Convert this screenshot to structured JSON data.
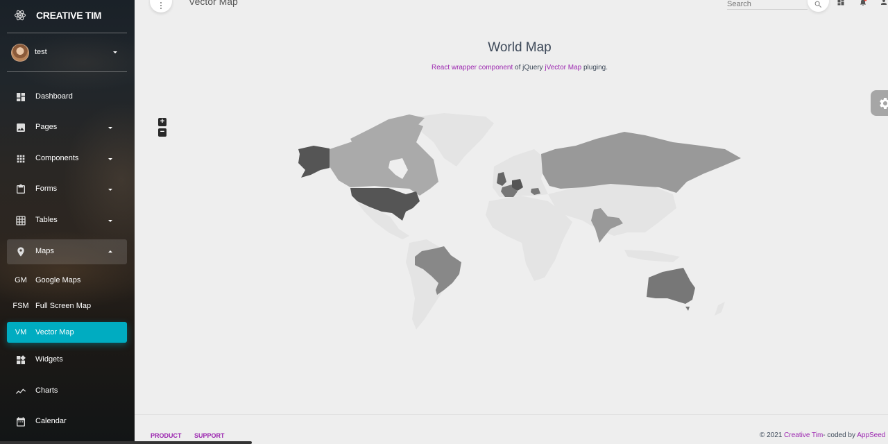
{
  "sidebar": {
    "brand": "CREATIVE TIM",
    "user": {
      "name": "test"
    },
    "items": [
      {
        "label": "Dashboard",
        "icon": "dashboard-icon",
        "has_caret": false
      },
      {
        "label": "Pages",
        "icon": "image-icon",
        "has_caret": true
      },
      {
        "label": "Components",
        "icon": "apps-icon",
        "has_caret": true
      },
      {
        "label": "Forms",
        "icon": "clipboard-icon",
        "has_caret": true
      },
      {
        "label": "Tables",
        "icon": "grid-on-icon",
        "has_caret": true
      },
      {
        "label": "Maps",
        "icon": "place-icon",
        "has_caret": true,
        "expanded": true
      },
      {
        "label": "Widgets",
        "icon": "widgets-icon",
        "has_caret": false
      },
      {
        "label": "Charts",
        "icon": "timeline-icon",
        "has_caret": false
      },
      {
        "label": "Calendar",
        "icon": "calendar-icon",
        "has_caret": false
      }
    ],
    "maps_subitems": [
      {
        "abbr": "GM",
        "label": "Google Maps",
        "active": false
      },
      {
        "abbr": "FSM",
        "label": "Full Screen Map",
        "active": false
      },
      {
        "abbr": "VM",
        "label": "Vector Map",
        "active": true
      }
    ],
    "active_color": "#00acc1"
  },
  "header": {
    "page_title": "Vector Map",
    "search_placeholder": "Search",
    "icons": [
      "search-icon",
      "dashboard-icon",
      "notifications-icon",
      "person-icon"
    ]
  },
  "card": {
    "title": "World Map",
    "subtitle_link1": "React wrapper component",
    "subtitle_mid": " of jQuery ",
    "subtitle_link2": "jVector Map",
    "subtitle_end": " pluging."
  },
  "map": {
    "zoom_in": "+",
    "zoom_out": "−",
    "highlighted_regions": [
      {
        "name": "United States",
        "shade": "#555555"
      },
      {
        "name": "Canada",
        "shade": "#aaaaaa"
      },
      {
        "name": "Brazil",
        "shade": "#888888"
      },
      {
        "name": "Russia",
        "shade": "#999999"
      },
      {
        "name": "Germany",
        "shade": "#555555"
      },
      {
        "name": "France",
        "shade": "#777777"
      },
      {
        "name": "United Kingdom",
        "shade": "#666666"
      },
      {
        "name": "Romania",
        "shade": "#777777"
      },
      {
        "name": "India",
        "shade": "#999999"
      },
      {
        "name": "Australia",
        "shade": "#777777"
      }
    ],
    "base_color": "#e4e4e4"
  },
  "footer": {
    "links": [
      "PRODUCT",
      "SUPPORT"
    ],
    "copyright_prefix": "© 2021 ",
    "copyright_link1": "Creative Tim",
    "copyright_mid": "- coded by ",
    "copyright_link2": "AppSeed"
  },
  "accent_color": "#9c27b0"
}
